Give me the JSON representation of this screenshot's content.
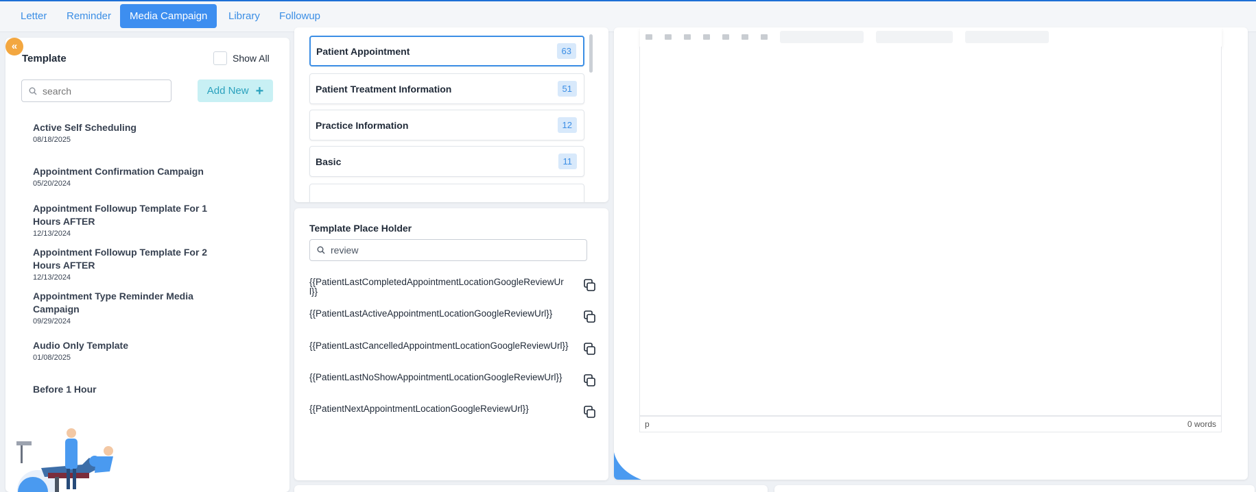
{
  "colors": {
    "accent": "#3d8ef0",
    "accent_text": "#3b8ee5",
    "collapse_button": "#f3a740",
    "add_new_bg": "#c8f0f4",
    "add_new_text": "#2aa1bd",
    "count_badge_bg": "#d8e9fb"
  },
  "tabs": [
    {
      "label": "Letter",
      "active": false
    },
    {
      "label": "Reminder",
      "active": false
    },
    {
      "label": "Media Campaign",
      "active": true
    },
    {
      "label": "Library",
      "active": false
    },
    {
      "label": "Followup",
      "active": false
    }
  ],
  "collapse_button": {
    "icon": "double-chevron-left-icon",
    "glyph": "«"
  },
  "template_panel": {
    "title": "Template",
    "show_all_label": "Show All",
    "show_all_checked": false,
    "search": {
      "placeholder": "search",
      "value": ""
    },
    "add_new_label": "Add New",
    "add_new_icon": "plus-icon",
    "templates": [
      {
        "name": "Active Self Scheduling",
        "date": "08/18/2025"
      },
      {
        "name": "Appointment Confirmation Campaign",
        "date": "05/20/2024"
      },
      {
        "name": "Appointment Followup Template For 1 Hours AFTER",
        "date": "12/13/2024"
      },
      {
        "name": "Appointment Followup Template For 2 Hours AFTER",
        "date": "12/13/2024"
      },
      {
        "name": "Appointment Type Reminder Media Campaign",
        "date": "09/29/2024"
      },
      {
        "name": "Audio Only Template",
        "date": "01/08/2025"
      },
      {
        "name": "Before 1 Hour",
        "date": ""
      }
    ]
  },
  "categories": [
    {
      "name": "Patient Appointment",
      "count": "63",
      "selected": true
    },
    {
      "name": "Patient Treatment Information",
      "count": "51",
      "selected": false
    },
    {
      "name": "Practice Information",
      "count": "12",
      "selected": false
    },
    {
      "name": "Basic",
      "count": "11",
      "selected": false
    }
  ],
  "placeholder_panel": {
    "title": "Template Place Holder",
    "search": {
      "value": "review",
      "icon": "search-icon"
    },
    "items": [
      {
        "text": "{{PatientLastCompletedAppointmentLocationGoogleReviewUrl}}",
        "icon": "copy-icon"
      },
      {
        "text": "{{PatientLastActiveAppointmentLocationGoogleReviewUrl}}",
        "icon": "copy-icon"
      },
      {
        "text": "{{PatientLastCancelledAppointmentLocationGoogleReviewUrl}}",
        "icon": "copy-icon"
      },
      {
        "text": "{{PatientLastNoShowAppointmentLocationGoogleReviewUrl}}",
        "icon": "copy-icon"
      },
      {
        "text": "{{PatientNextAppointmentLocationGoogleReviewUrl}}",
        "icon": "copy-icon"
      }
    ]
  },
  "editor": {
    "status_element": "p",
    "word_count": "0 words"
  }
}
